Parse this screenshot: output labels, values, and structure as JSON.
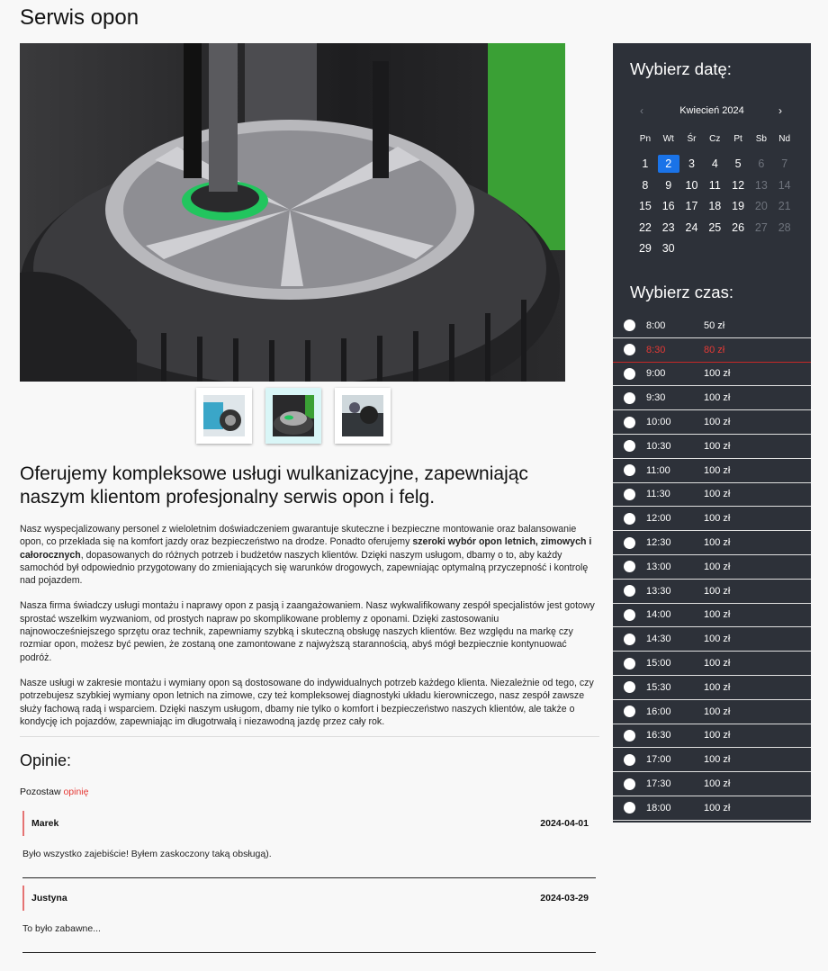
{
  "page": {
    "title": "Serwis opon"
  },
  "gallery": {
    "thumbnails": [
      "thumb-1",
      "thumb-2",
      "thumb-3"
    ],
    "active_index": 1
  },
  "service": {
    "headline": "Oferujemy kompleksowe usługi wulkanizacyjne, zapewniając naszym klientom profesjonalny serwis opon i felg.",
    "p1_a": "Nasz wyspecjalizowany personel z wieloletnim doświadczeniem gwarantuje skuteczne i bezpieczne montowanie oraz balansowanie opon, co przekłada się na komfort jazdy oraz bezpieczeństwo na drodze. Ponadto oferujemy ",
    "p1_bold": "szeroki wybór opon letnich, zimowych i całorocznych",
    "p1_b": ", dopasowanych do różnych potrzeb i budżetów naszych klientów. Dzięki naszym usługom, dbamy o to, aby każdy samochód był odpowiednio przygotowany do zmieniających się warunków drogowych, zapewniając optymalną przyczepność i kontrolę nad pojazdem.",
    "p2": "Nasza firma świadczy usługi montażu i naprawy opon z pasją i zaangażowaniem. Nasz wykwalifikowany zespół specjalistów jest gotowy sprostać wszelkim wyzwaniom, od prostych napraw po skomplikowane problemy z oponami. Dzięki zastosowaniu najnowocześniejszego sprzętu oraz technik, zapewniamy szybką i skuteczną obsługę naszych klientów. Bez względu na markę czy rozmiar opon, możesz być pewien, że zostaną one zamontowane z najwyższą starannością, abyś mógł bezpiecznie kontynuować podróż.",
    "p3": "Nasze usługi w zakresie montażu i wymiany opon są dostosowane do indywidualnych potrzeb każdego klienta. Niezależnie od tego, czy potrzebujesz szybkiej wymiany opon letnich na zimowe, czy też kompleksowej diagnostyki układu kierowniczego, nasz zespół zawsze służy fachową radą i wsparciem. Dzięki naszym usługom, dbamy nie tylko o komfort i bezpieczeństwo naszych klientów, ale także o kondycję ich pojazdów, zapewniając im długotrwałą i niezawodną jazdę przez cały rok."
  },
  "reviews": {
    "title": "Opinie:",
    "leave_prefix": "Pozostaw ",
    "leave_link": "opinię",
    "items": [
      {
        "author": "Marek",
        "date": "2024-04-01",
        "text": "Było wszystko zajebiście! Byłem zaskoczony taką obsługą)."
      },
      {
        "author": "Justyna",
        "date": "2024-03-29",
        "text": "To było zabawne..."
      }
    ]
  },
  "calendar": {
    "title": "Wybierz datę:",
    "month": "Kwiecień 2024",
    "prev": "‹",
    "next": "›",
    "weekdays": [
      "Pn",
      "Wt",
      "Śr",
      "Cz",
      "Pt",
      "Sb",
      "Nd"
    ],
    "days": [
      1,
      2,
      3,
      4,
      5,
      6,
      7,
      8,
      9,
      10,
      11,
      12,
      13,
      14,
      15,
      16,
      17,
      18,
      19,
      20,
      21,
      22,
      23,
      24,
      25,
      26,
      27,
      28,
      29,
      30
    ],
    "selected": 2,
    "colors": {
      "selected": "#1a73e8",
      "weekend": "#6e737c"
    }
  },
  "time": {
    "title": "Wybierz czas:",
    "slots": [
      {
        "time": "8:00",
        "price": "50 zł",
        "busy": false
      },
      {
        "time": "8:30",
        "price": "80 zł",
        "busy": true
      },
      {
        "time": "9:00",
        "price": "100 zł",
        "busy": false
      },
      {
        "time": "9:30",
        "price": "100 zł",
        "busy": false
      },
      {
        "time": "10:00",
        "price": "100 zł",
        "busy": false
      },
      {
        "time": "10:30",
        "price": "100 zł",
        "busy": false
      },
      {
        "time": "11:00",
        "price": "100 zł",
        "busy": false
      },
      {
        "time": "11:30",
        "price": "100 zł",
        "busy": false
      },
      {
        "time": "12:00",
        "price": "100 zł",
        "busy": false
      },
      {
        "time": "12:30",
        "price": "100 zł",
        "busy": false
      },
      {
        "time": "13:00",
        "price": "100 zł",
        "busy": false
      },
      {
        "time": "13:30",
        "price": "100 zł",
        "busy": false
      },
      {
        "time": "14:00",
        "price": "100 zł",
        "busy": false
      },
      {
        "time": "14:30",
        "price": "100 zł",
        "busy": false
      },
      {
        "time": "15:00",
        "price": "100 zł",
        "busy": false
      },
      {
        "time": "15:30",
        "price": "100 zł",
        "busy": false
      },
      {
        "time": "16:00",
        "price": "100 zł",
        "busy": false
      },
      {
        "time": "16:30",
        "price": "100 zł",
        "busy": false
      },
      {
        "time": "17:00",
        "price": "100 zł",
        "busy": false
      },
      {
        "time": "17:30",
        "price": "100 zł",
        "busy": false
      },
      {
        "time": "18:00",
        "price": "100 zł",
        "busy": false
      }
    ],
    "colors": {
      "busy": "#e53935"
    }
  }
}
